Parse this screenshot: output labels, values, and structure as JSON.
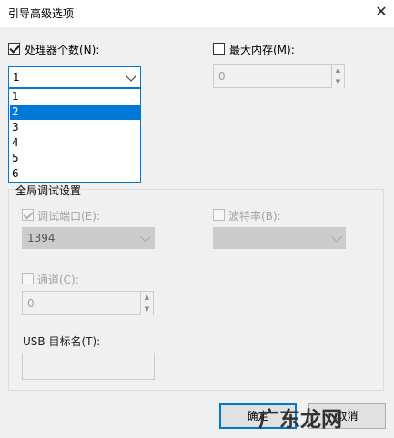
{
  "window": {
    "title": "引导高级选项",
    "close_glyph": "✕"
  },
  "processors": {
    "label": "处理器个数(N):",
    "checked": true,
    "selected": "1",
    "options": [
      "1",
      "2",
      "3",
      "4",
      "5",
      "6"
    ],
    "highlighted": "2"
  },
  "max_memory": {
    "label": "最大内存(M):",
    "checked": false,
    "value": "0"
  },
  "debug": {
    "group_label": "全局调试设置",
    "port_label": "调试端口(E):",
    "port_checked": true,
    "port_value": "1394",
    "baud_label": "波特率(B):",
    "baud_checked": false,
    "baud_value": "",
    "channel_label": "通道(C):",
    "channel_checked": false,
    "channel_value": "0",
    "usb_label": "USB 目标名(T):",
    "usb_value": ""
  },
  "buttons": {
    "ok": "确定",
    "cancel": "取消"
  },
  "watermark": {
    "text": "广东龙网"
  },
  "colors": {
    "accent": "#0078d7",
    "background": "#f0f0f0",
    "disabled_text": "#a3a3a3"
  }
}
